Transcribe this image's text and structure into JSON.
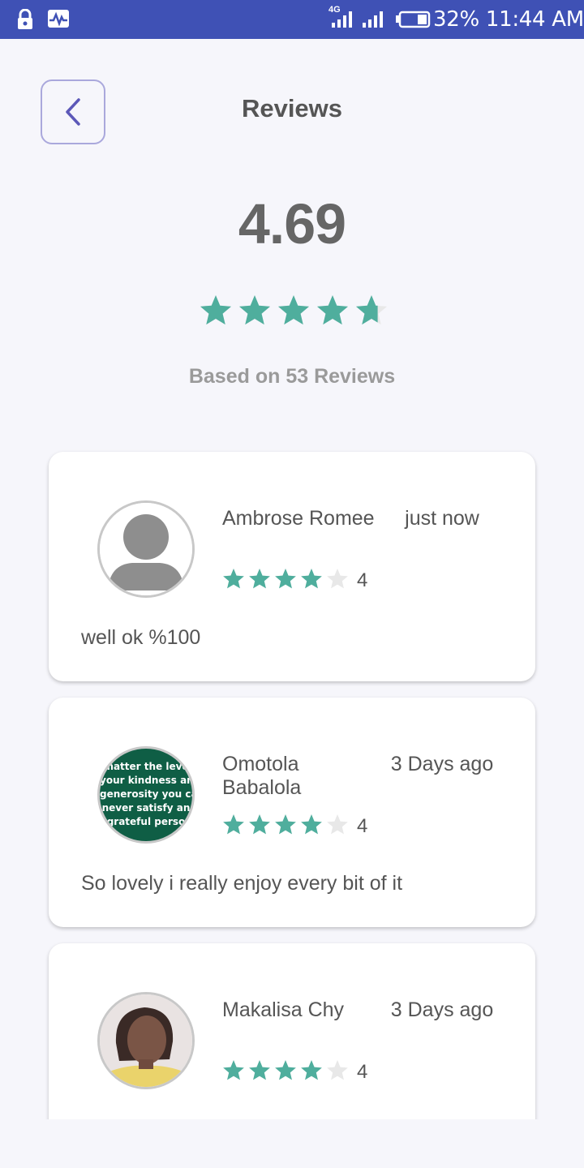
{
  "status_bar": {
    "network": "4G",
    "battery": "32%",
    "time": "11:44 AM",
    "icons": [
      "lock-icon",
      "activity-icon",
      "signal-icon",
      "battery-icon"
    ]
  },
  "header": {
    "title": "Reviews",
    "back_icon": "chevron-left-icon"
  },
  "summary": {
    "average": "4.69",
    "average_value": 4.69,
    "max_stars": 5,
    "based_on": "Based on 53 Reviews"
  },
  "colors": {
    "status_bar": "#3f51b5",
    "star": "#4fae9d",
    "star_empty": "#e8e8e8",
    "back_border": "#aaa8dc"
  },
  "reviews": [
    {
      "name": "Ambrose Romee",
      "time": "just now",
      "rating": 4,
      "rating_label": "4",
      "text": "well ok %100",
      "avatar": "default-person-avatar"
    },
    {
      "name": "Omotola Babalola",
      "time": "3 Days ago",
      "rating": 4,
      "rating_label": "4",
      "text": "So lovely i really enjoy every bit of it",
      "avatar": "quote-avatar",
      "avatar_lines": [
        "matter the leve",
        "your kindness and",
        "generosity you can",
        "never satisfy an",
        "grateful perso"
      ]
    },
    {
      "name": "Makalisa Chy",
      "time": "3 Days ago",
      "rating": 4,
      "rating_label": "4",
      "text": "",
      "avatar": "photo-avatar"
    }
  ]
}
